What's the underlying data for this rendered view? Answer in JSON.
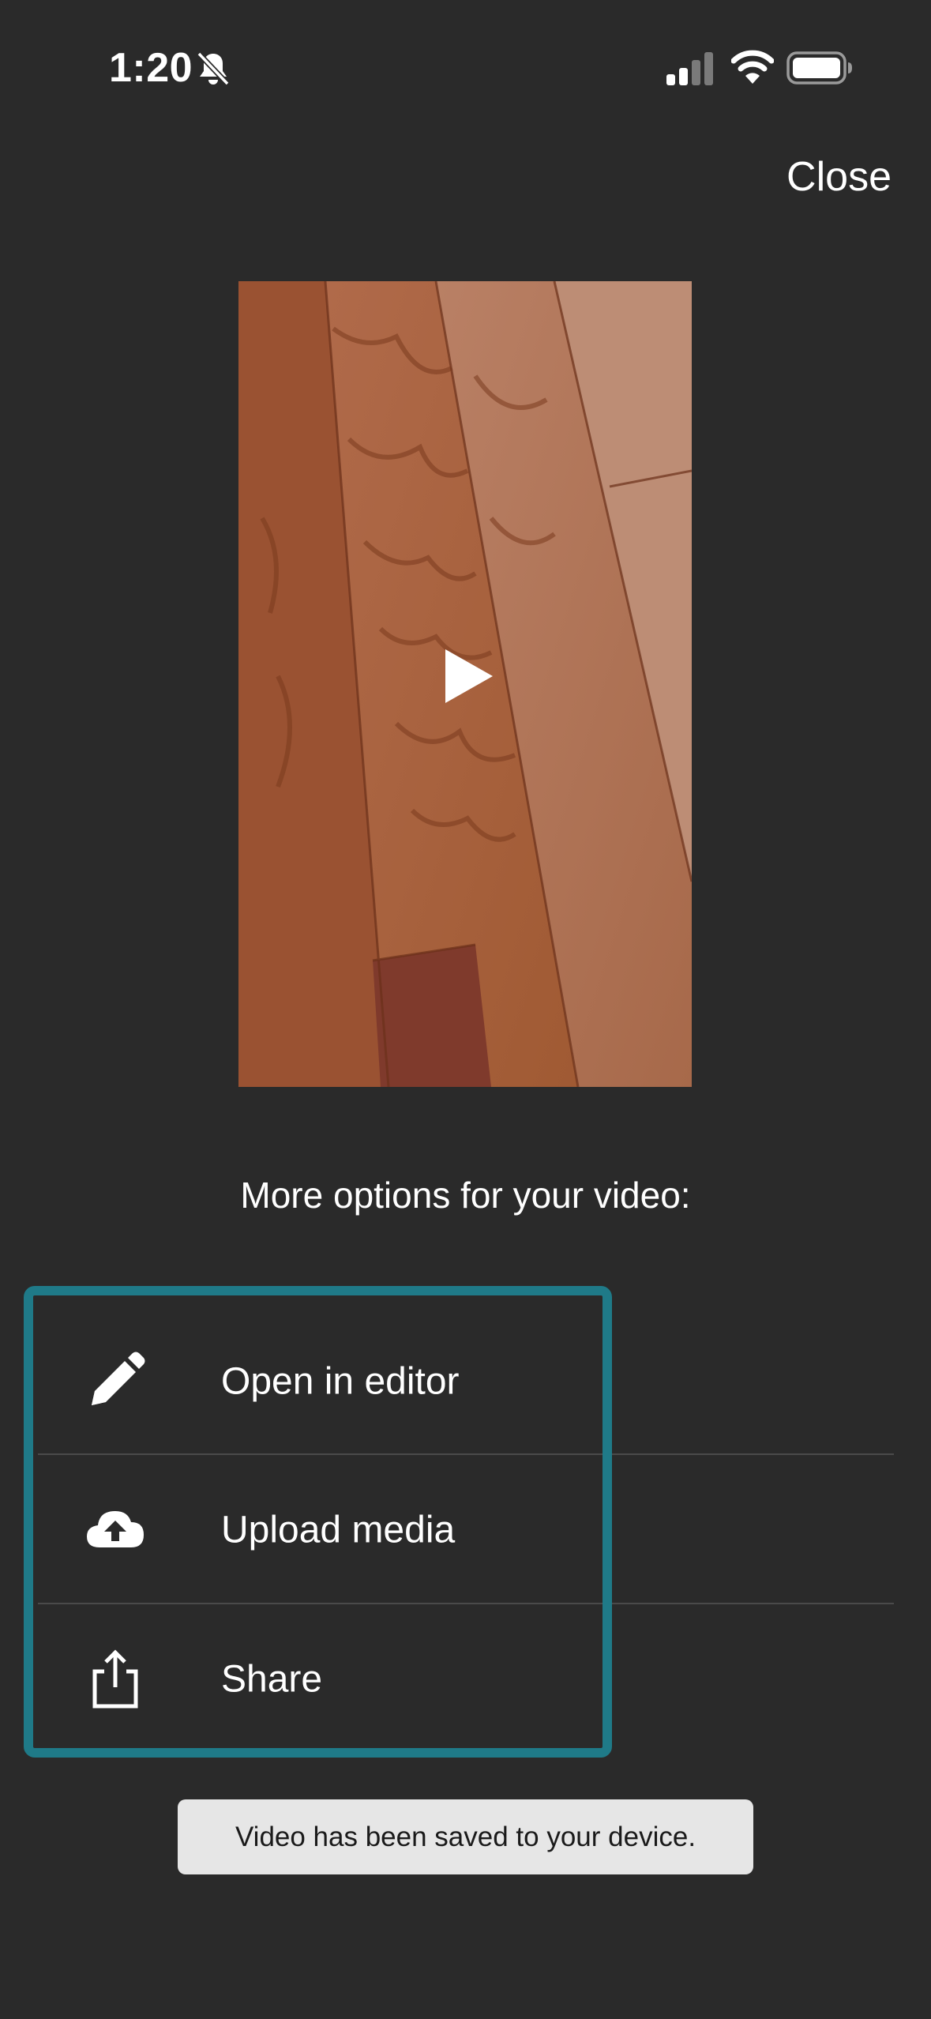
{
  "status_bar": {
    "time": "1:20",
    "icons": [
      "bell-slash-icon",
      "signal-icon",
      "wifi-icon",
      "battery-icon"
    ]
  },
  "header": {
    "close_label": "Close"
  },
  "video": {
    "play_icon": "play-icon"
  },
  "options": {
    "heading": "More options for your video:",
    "items": [
      {
        "label": "Open in editor",
        "icon": "pencil-icon"
      },
      {
        "label": "Upload media",
        "icon": "cloud-upload-icon"
      },
      {
        "label": "Share",
        "icon": "share-icon"
      }
    ],
    "highlight_color": "#1f7a88"
  },
  "toast": {
    "message": "Video has been saved to your device."
  },
  "colors": {
    "background": "#2a2a2a",
    "toast_background": "#e6e6e6"
  }
}
